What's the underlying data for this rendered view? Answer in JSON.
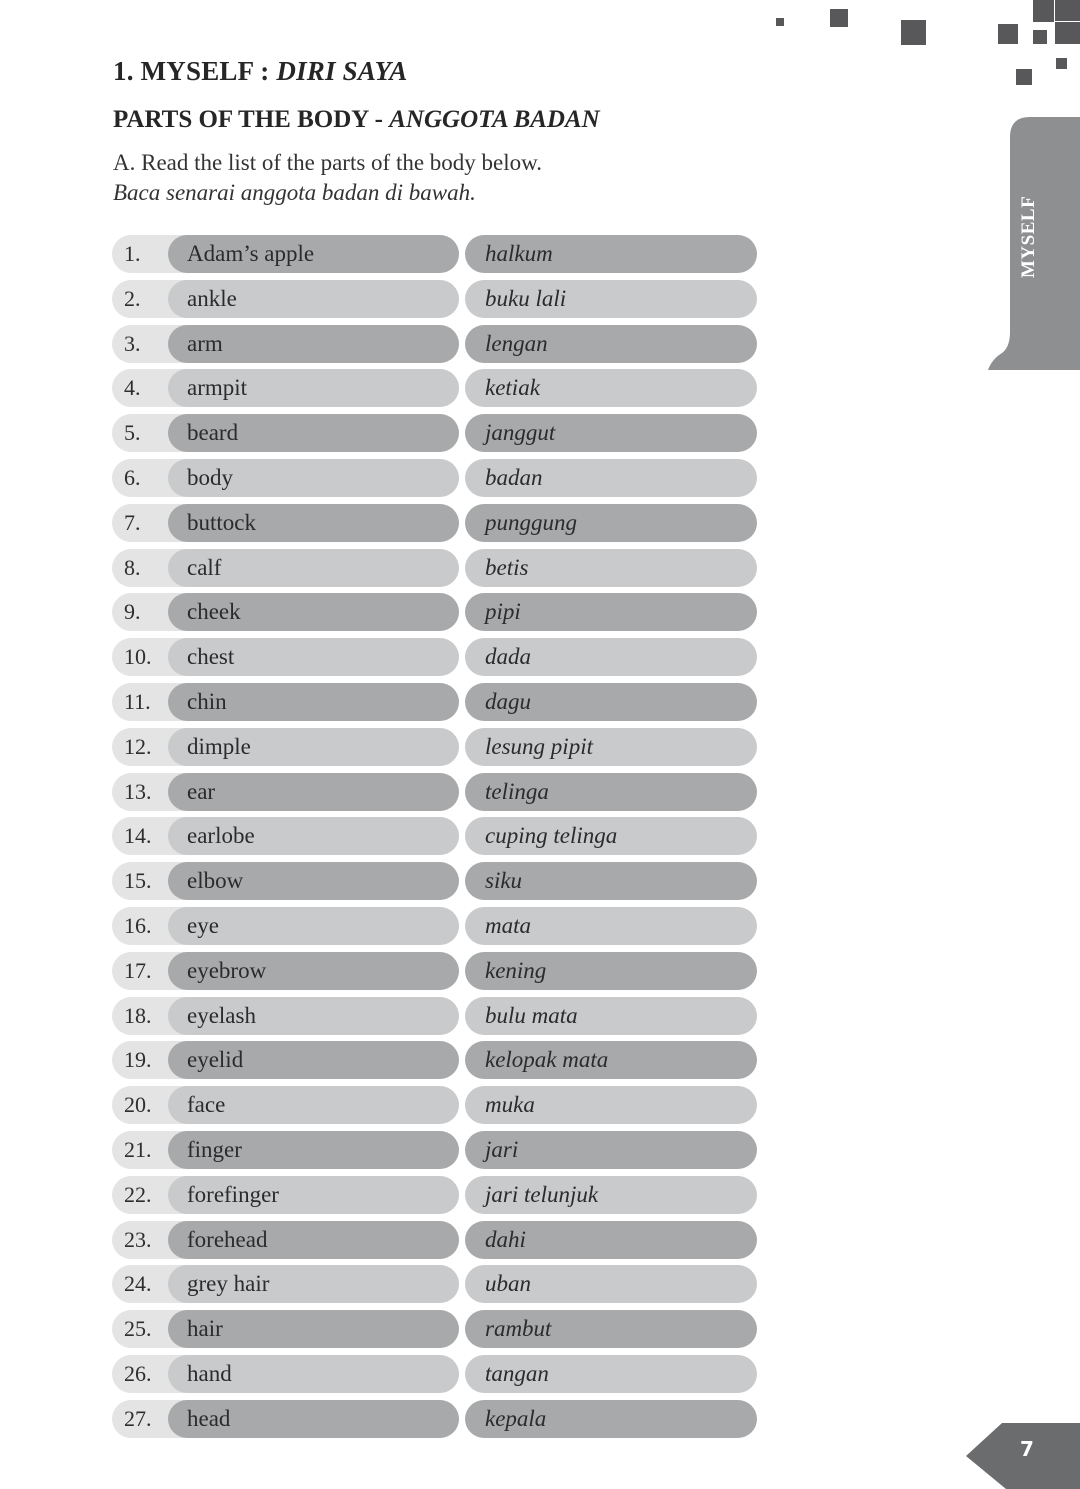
{
  "header": {
    "title_prefix": "1. MYSELF : ",
    "title_italic": "DIRI SAYA",
    "subtitle_prefix": "PARTS OF THE BODY - ",
    "subtitle_italic": "ANGGOTA BADAN",
    "instruction_en": "A. Read the list of the parts of the body below.",
    "instruction_ms": "Baca senarai anggota badan di bawah."
  },
  "side_tab": {
    "label": "MYSELF",
    "color": "#8e8f91"
  },
  "colors": {
    "dark_pill": "#a8a9ab",
    "light_pill": "#c9cacc",
    "outer_pill": "#e4e4e5"
  },
  "items": [
    {
      "num": "1.",
      "en": "Adam’s apple",
      "ms": "halkum",
      "shade": "dark"
    },
    {
      "num": "2.",
      "en": "ankle",
      "ms": "buku lali",
      "shade": "light"
    },
    {
      "num": "3.",
      "en": "arm",
      "ms": "lengan",
      "shade": "dark"
    },
    {
      "num": "4.",
      "en": "armpit",
      "ms": "ketiak",
      "shade": "light"
    },
    {
      "num": "5.",
      "en": "beard",
      "ms": "janggut",
      "shade": "dark"
    },
    {
      "num": "6.",
      "en": "body",
      "ms": "badan",
      "shade": "light"
    },
    {
      "num": "7.",
      "en": "buttock",
      "ms": "punggung",
      "shade": "dark"
    },
    {
      "num": "8.",
      "en": "calf",
      "ms": "betis",
      "shade": "light"
    },
    {
      "num": "9.",
      "en": "cheek",
      "ms": "pipi",
      "shade": "dark"
    },
    {
      "num": "10.",
      "en": "chest",
      "ms": "dada",
      "shade": "light"
    },
    {
      "num": "11.",
      "en": "chin",
      "ms": "dagu",
      "shade": "dark"
    },
    {
      "num": "12.",
      "en": "dimple",
      "ms": "lesung pipit",
      "shade": "light"
    },
    {
      "num": "13.",
      "en": "ear",
      "ms": "telinga",
      "shade": "dark"
    },
    {
      "num": "14.",
      "en": "earlobe",
      "ms": "cuping telinga",
      "shade": "light"
    },
    {
      "num": "15.",
      "en": "elbow",
      "ms": "siku",
      "shade": "dark"
    },
    {
      "num": "16.",
      "en": "eye",
      "ms": "mata",
      "shade": "light"
    },
    {
      "num": "17.",
      "en": "eyebrow",
      "ms": "kening",
      "shade": "dark"
    },
    {
      "num": "18.",
      "en": "eyelash",
      "ms": "bulu mata",
      "shade": "light"
    },
    {
      "num": "19.",
      "en": "eyelid",
      "ms": "kelopak mata",
      "shade": "dark"
    },
    {
      "num": "20.",
      "en": "face",
      "ms": "muka",
      "shade": "light"
    },
    {
      "num": "21.",
      "en": "finger",
      "ms": "jari",
      "shade": "dark"
    },
    {
      "num": "22.",
      "en": "forefinger",
      "ms": "jari telunjuk",
      "shade": "light"
    },
    {
      "num": "23.",
      "en": "forehead",
      "ms": "dahi",
      "shade": "dark"
    },
    {
      "num": "24.",
      "en": "grey hair",
      "ms": "uban",
      "shade": "light"
    },
    {
      "num": "25.",
      "en": "hair",
      "ms": "rambut",
      "shade": "dark"
    },
    {
      "num": "26.",
      "en": "hand",
      "ms": "tangan",
      "shade": "light"
    },
    {
      "num": "27.",
      "en": "head",
      "ms": "kepala",
      "shade": "dark"
    }
  ],
  "footer": {
    "page_number": "7"
  }
}
